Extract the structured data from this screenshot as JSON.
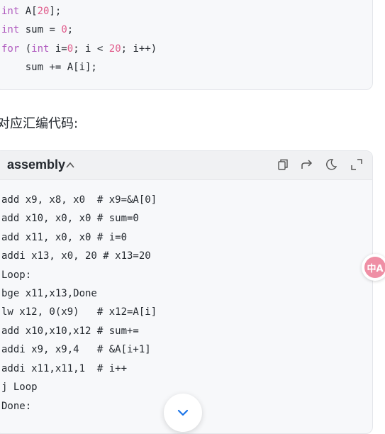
{
  "c_code": {
    "line1": {
      "kw": "int",
      "rest1": " A[",
      "num": "20",
      "rest2": "];"
    },
    "line2": {
      "kw": "int",
      "rest1": " sum = ",
      "num": "0",
      "rest2": ";"
    },
    "line3": {
      "kw": "for",
      "p1": " (",
      "kw2": "int",
      "p2": " i=",
      "n1": "0",
      "p3": "; i < ",
      "n2": "20",
      "p4": "; i++)"
    },
    "line4": "    sum += A[i];"
  },
  "heading": "对应汇编代码:",
  "assembly_block": {
    "language": "assembly",
    "toolbar": [
      "copy-icon",
      "share-icon",
      "theme-icon",
      "expand-icon"
    ],
    "lines": [
      "add x9, x8, x0  # x9=&A[0]",
      "add x10, x0, x0 # sum=0",
      "add x11, x0, x0 # i=0",
      "addi x13, x0, 20 # x13=20",
      "Loop:",
      "bge x11,x13,Done",
      "lw x12, 0(x9)   # x12=A[i]",
      "add x10,x10,x12 # sum+=",
      "addi x9, x9,4   # &A[i+1]",
      "addi x11,x11,1  # i++",
      "j Loop",
      "Done:"
    ]
  },
  "translate_button": {
    "label": "中A"
  },
  "colors": {
    "keyword": "#b05bbf",
    "number": "#e05a8a",
    "accent": "#1a73e8"
  }
}
